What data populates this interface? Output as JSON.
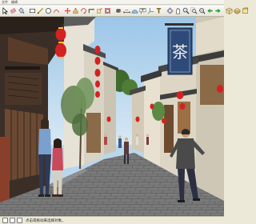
{
  "menu": {
    "items": [
      "文件",
      "编辑"
    ]
  },
  "toolbar": {
    "tools": [
      "select-tool-icon",
      "eraser-tool-icon",
      "paint-bucket-icon",
      "rectangle-tool-icon",
      "line-tool-icon",
      "circle-tool-icon",
      "arc-tool-icon",
      "move-tool-icon",
      "push-pull-icon",
      "rotate-tool-icon",
      "follow-me-icon",
      "scale-tool-icon",
      "offset-tool-icon",
      "tape-measure-icon",
      "dimension-icon",
      "protractor-icon",
      "text-tool-icon",
      "axes-icon",
      "3d-text-icon",
      "orbit-icon",
      "pan-icon",
      "zoom-icon",
      "zoom-window-icon",
      "zoom-extents-icon",
      "previous-view-icon",
      "next-view-icon",
      "iso-view-icon",
      "top-view-icon",
      "front-view-icon"
    ]
  },
  "scene": {
    "sign_text": "茶"
  },
  "colors": {
    "sky": "#b9d6ec",
    "pavement": "#6e6e6e",
    "lantern": "#d32222",
    "sign": "#2e4a78"
  },
  "statusbar": {
    "text": "点击或拖动来选择对象。"
  }
}
